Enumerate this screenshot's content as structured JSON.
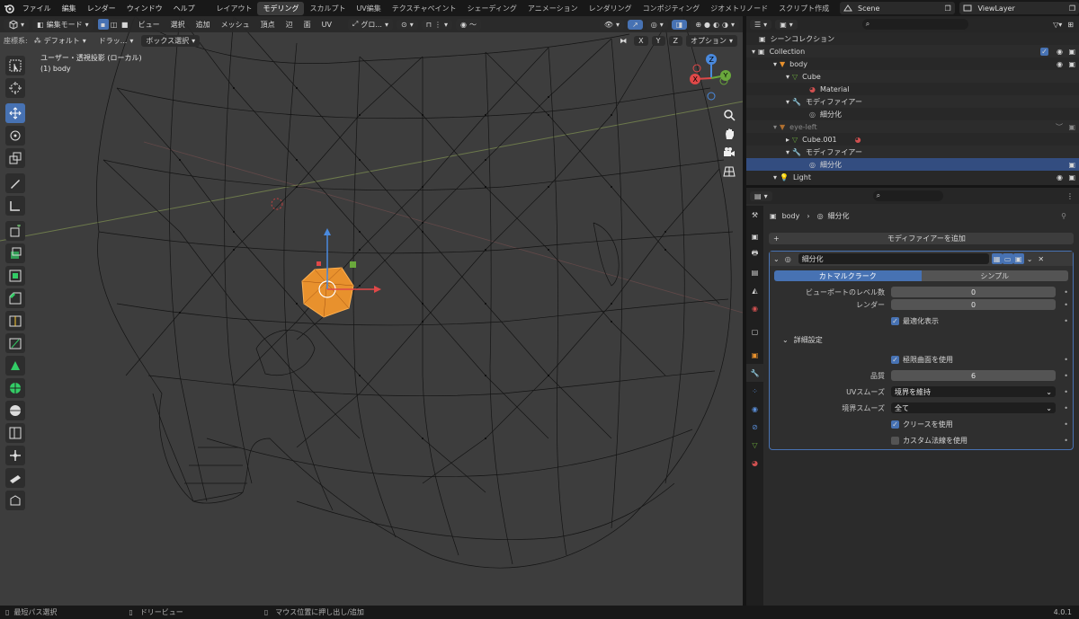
{
  "topbar": {
    "menus": [
      "ファイル",
      "編集",
      "レンダー",
      "ウィンドウ",
      "ヘルプ"
    ],
    "workspaces": [
      "レイアウト",
      "モデリング",
      "スカルプト",
      "UV編集",
      "テクスチャペイント",
      "シェーディング",
      "アニメーション",
      "レンダリング",
      "コンポジティング",
      "ジオメトリノード",
      "スクリプト作成"
    ],
    "active_workspace": "モデリング",
    "scene": "Scene",
    "view_layer": "ViewLayer"
  },
  "viewport_header": {
    "mode": "編集モード",
    "menus": [
      "ビュー",
      "選択",
      "追加",
      "メッシュ",
      "頂点",
      "辺",
      "面",
      "UV"
    ],
    "orientation": "グロ...",
    "options": "オプション",
    "axes": [
      "X",
      "Y",
      "Z"
    ]
  },
  "viewport_header2": {
    "coord_label": "座標系:",
    "coord_value": "デフォルト",
    "drag_label": "ドラッ...",
    "select_mode": "ボックス選択"
  },
  "viewport_info": {
    "view_name": "ユーザー・透視投影 (ローカル)",
    "object": "(1) body"
  },
  "gizmo": {
    "z": "Z",
    "y": "Y",
    "x": "X"
  },
  "outliner": {
    "root": "シーンコレクション",
    "collection": "Collection",
    "items": [
      {
        "label": "body",
        "level": 2
      },
      {
        "label": "Cube",
        "level": 3
      },
      {
        "label": "Material",
        "level": 4
      },
      {
        "label": "モディファイアー",
        "level": 3
      },
      {
        "label": "細分化",
        "level": 4
      },
      {
        "label": "eye-left",
        "level": 2
      },
      {
        "label": "Cube.001",
        "level": 3
      },
      {
        "label": "モディファイアー",
        "level": 3
      },
      {
        "label": "細分化",
        "level": 4
      },
      {
        "label": "Light",
        "level": 2
      }
    ]
  },
  "properties": {
    "breadcrumb_object": "body",
    "breadcrumb_modifier": "細分化",
    "add_modifier": "モディファイアーを追加",
    "modifier_name": "細分化",
    "tab_catmull": "カトマルクラーク",
    "tab_simple": "シンプル",
    "viewport_levels_label": "ビューポートのレベル数",
    "viewport_levels_value": "0",
    "render_label": "レンダー",
    "render_value": "0",
    "optimal_display": "最適化表示",
    "advanced": "詳細設定",
    "use_limit_surface": "極限曲面を使用",
    "quality_label": "品質",
    "quality_value": "6",
    "uv_smooth_label": "UVスムーズ",
    "uv_smooth_value": "境界を維持",
    "boundary_smooth_label": "境界スムーズ",
    "boundary_smooth_value": "全て",
    "use_creases": "クリースを使用",
    "use_custom_normals": "カスタム法線を使用"
  },
  "statusbar": {
    "left": "最短パス選択",
    "middle": "ドリービュー",
    "right": "マウス位置に押し出し/追加",
    "version": "4.0.1"
  },
  "colors": {
    "accent": "#4772b3",
    "selected_row": "#334d80",
    "mesh_selection": "#e8912d"
  }
}
